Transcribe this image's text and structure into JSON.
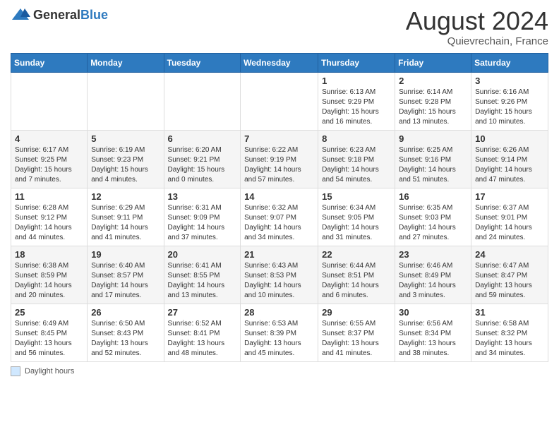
{
  "header": {
    "logo_general": "General",
    "logo_blue": "Blue",
    "title": "August 2024",
    "subtitle": "Quievrechain, France"
  },
  "legend": {
    "label": "Daylight hours"
  },
  "days_of_week": [
    "Sunday",
    "Monday",
    "Tuesday",
    "Wednesday",
    "Thursday",
    "Friday",
    "Saturday"
  ],
  "weeks": [
    [
      {
        "day": "",
        "info": ""
      },
      {
        "day": "",
        "info": ""
      },
      {
        "day": "",
        "info": ""
      },
      {
        "day": "",
        "info": ""
      },
      {
        "day": "1",
        "info": "Sunrise: 6:13 AM\nSunset: 9:29 PM\nDaylight: 15 hours and 16 minutes."
      },
      {
        "day": "2",
        "info": "Sunrise: 6:14 AM\nSunset: 9:28 PM\nDaylight: 15 hours and 13 minutes."
      },
      {
        "day": "3",
        "info": "Sunrise: 6:16 AM\nSunset: 9:26 PM\nDaylight: 15 hours and 10 minutes."
      }
    ],
    [
      {
        "day": "4",
        "info": "Sunrise: 6:17 AM\nSunset: 9:25 PM\nDaylight: 15 hours and 7 minutes."
      },
      {
        "day": "5",
        "info": "Sunrise: 6:19 AM\nSunset: 9:23 PM\nDaylight: 15 hours and 4 minutes."
      },
      {
        "day": "6",
        "info": "Sunrise: 6:20 AM\nSunset: 9:21 PM\nDaylight: 15 hours and 0 minutes."
      },
      {
        "day": "7",
        "info": "Sunrise: 6:22 AM\nSunset: 9:19 PM\nDaylight: 14 hours and 57 minutes."
      },
      {
        "day": "8",
        "info": "Sunrise: 6:23 AM\nSunset: 9:18 PM\nDaylight: 14 hours and 54 minutes."
      },
      {
        "day": "9",
        "info": "Sunrise: 6:25 AM\nSunset: 9:16 PM\nDaylight: 14 hours and 51 minutes."
      },
      {
        "day": "10",
        "info": "Sunrise: 6:26 AM\nSunset: 9:14 PM\nDaylight: 14 hours and 47 minutes."
      }
    ],
    [
      {
        "day": "11",
        "info": "Sunrise: 6:28 AM\nSunset: 9:12 PM\nDaylight: 14 hours and 44 minutes."
      },
      {
        "day": "12",
        "info": "Sunrise: 6:29 AM\nSunset: 9:11 PM\nDaylight: 14 hours and 41 minutes."
      },
      {
        "day": "13",
        "info": "Sunrise: 6:31 AM\nSunset: 9:09 PM\nDaylight: 14 hours and 37 minutes."
      },
      {
        "day": "14",
        "info": "Sunrise: 6:32 AM\nSunset: 9:07 PM\nDaylight: 14 hours and 34 minutes."
      },
      {
        "day": "15",
        "info": "Sunrise: 6:34 AM\nSunset: 9:05 PM\nDaylight: 14 hours and 31 minutes."
      },
      {
        "day": "16",
        "info": "Sunrise: 6:35 AM\nSunset: 9:03 PM\nDaylight: 14 hours and 27 minutes."
      },
      {
        "day": "17",
        "info": "Sunrise: 6:37 AM\nSunset: 9:01 PM\nDaylight: 14 hours and 24 minutes."
      }
    ],
    [
      {
        "day": "18",
        "info": "Sunrise: 6:38 AM\nSunset: 8:59 PM\nDaylight: 14 hours and 20 minutes."
      },
      {
        "day": "19",
        "info": "Sunrise: 6:40 AM\nSunset: 8:57 PM\nDaylight: 14 hours and 17 minutes."
      },
      {
        "day": "20",
        "info": "Sunrise: 6:41 AM\nSunset: 8:55 PM\nDaylight: 14 hours and 13 minutes."
      },
      {
        "day": "21",
        "info": "Sunrise: 6:43 AM\nSunset: 8:53 PM\nDaylight: 14 hours and 10 minutes."
      },
      {
        "day": "22",
        "info": "Sunrise: 6:44 AM\nSunset: 8:51 PM\nDaylight: 14 hours and 6 minutes."
      },
      {
        "day": "23",
        "info": "Sunrise: 6:46 AM\nSunset: 8:49 PM\nDaylight: 14 hours and 3 minutes."
      },
      {
        "day": "24",
        "info": "Sunrise: 6:47 AM\nSunset: 8:47 PM\nDaylight: 13 hours and 59 minutes."
      }
    ],
    [
      {
        "day": "25",
        "info": "Sunrise: 6:49 AM\nSunset: 8:45 PM\nDaylight: 13 hours and 56 minutes."
      },
      {
        "day": "26",
        "info": "Sunrise: 6:50 AM\nSunset: 8:43 PM\nDaylight: 13 hours and 52 minutes."
      },
      {
        "day": "27",
        "info": "Sunrise: 6:52 AM\nSunset: 8:41 PM\nDaylight: 13 hours and 48 minutes."
      },
      {
        "day": "28",
        "info": "Sunrise: 6:53 AM\nSunset: 8:39 PM\nDaylight: 13 hours and 45 minutes."
      },
      {
        "day": "29",
        "info": "Sunrise: 6:55 AM\nSunset: 8:37 PM\nDaylight: 13 hours and 41 minutes."
      },
      {
        "day": "30",
        "info": "Sunrise: 6:56 AM\nSunset: 8:34 PM\nDaylight: 13 hours and 38 minutes."
      },
      {
        "day": "31",
        "info": "Sunrise: 6:58 AM\nSunset: 8:32 PM\nDaylight: 13 hours and 34 minutes."
      }
    ]
  ]
}
